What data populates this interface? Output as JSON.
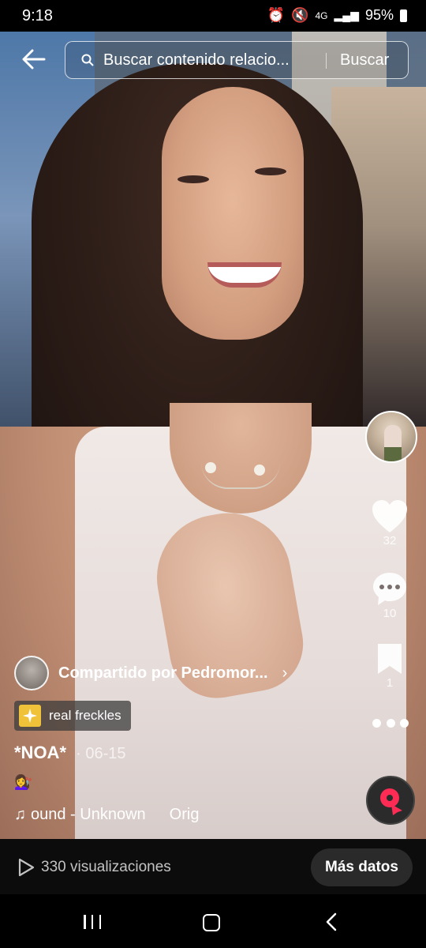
{
  "status_bar": {
    "time": "9:18",
    "network": "4G",
    "battery": "95%"
  },
  "search": {
    "placeholder": "Buscar contenido relacio...",
    "button": "Buscar"
  },
  "rail": {
    "likes": "32",
    "comments": "10",
    "saves": "1"
  },
  "caption": {
    "shared_by": "Compartido por Pedromor...",
    "effect": "real freckles",
    "author": "*NOA*",
    "date": "· 06-15",
    "emoji": "💇‍♀️",
    "music_title": "ound - Unknown",
    "music_orig": "Orig"
  },
  "bottom_bar": {
    "views": "330 visualizaciones",
    "more_data": "Más datos"
  },
  "colors": {
    "accent": "#fe2c55",
    "effect_tag": "#f0c23a"
  }
}
